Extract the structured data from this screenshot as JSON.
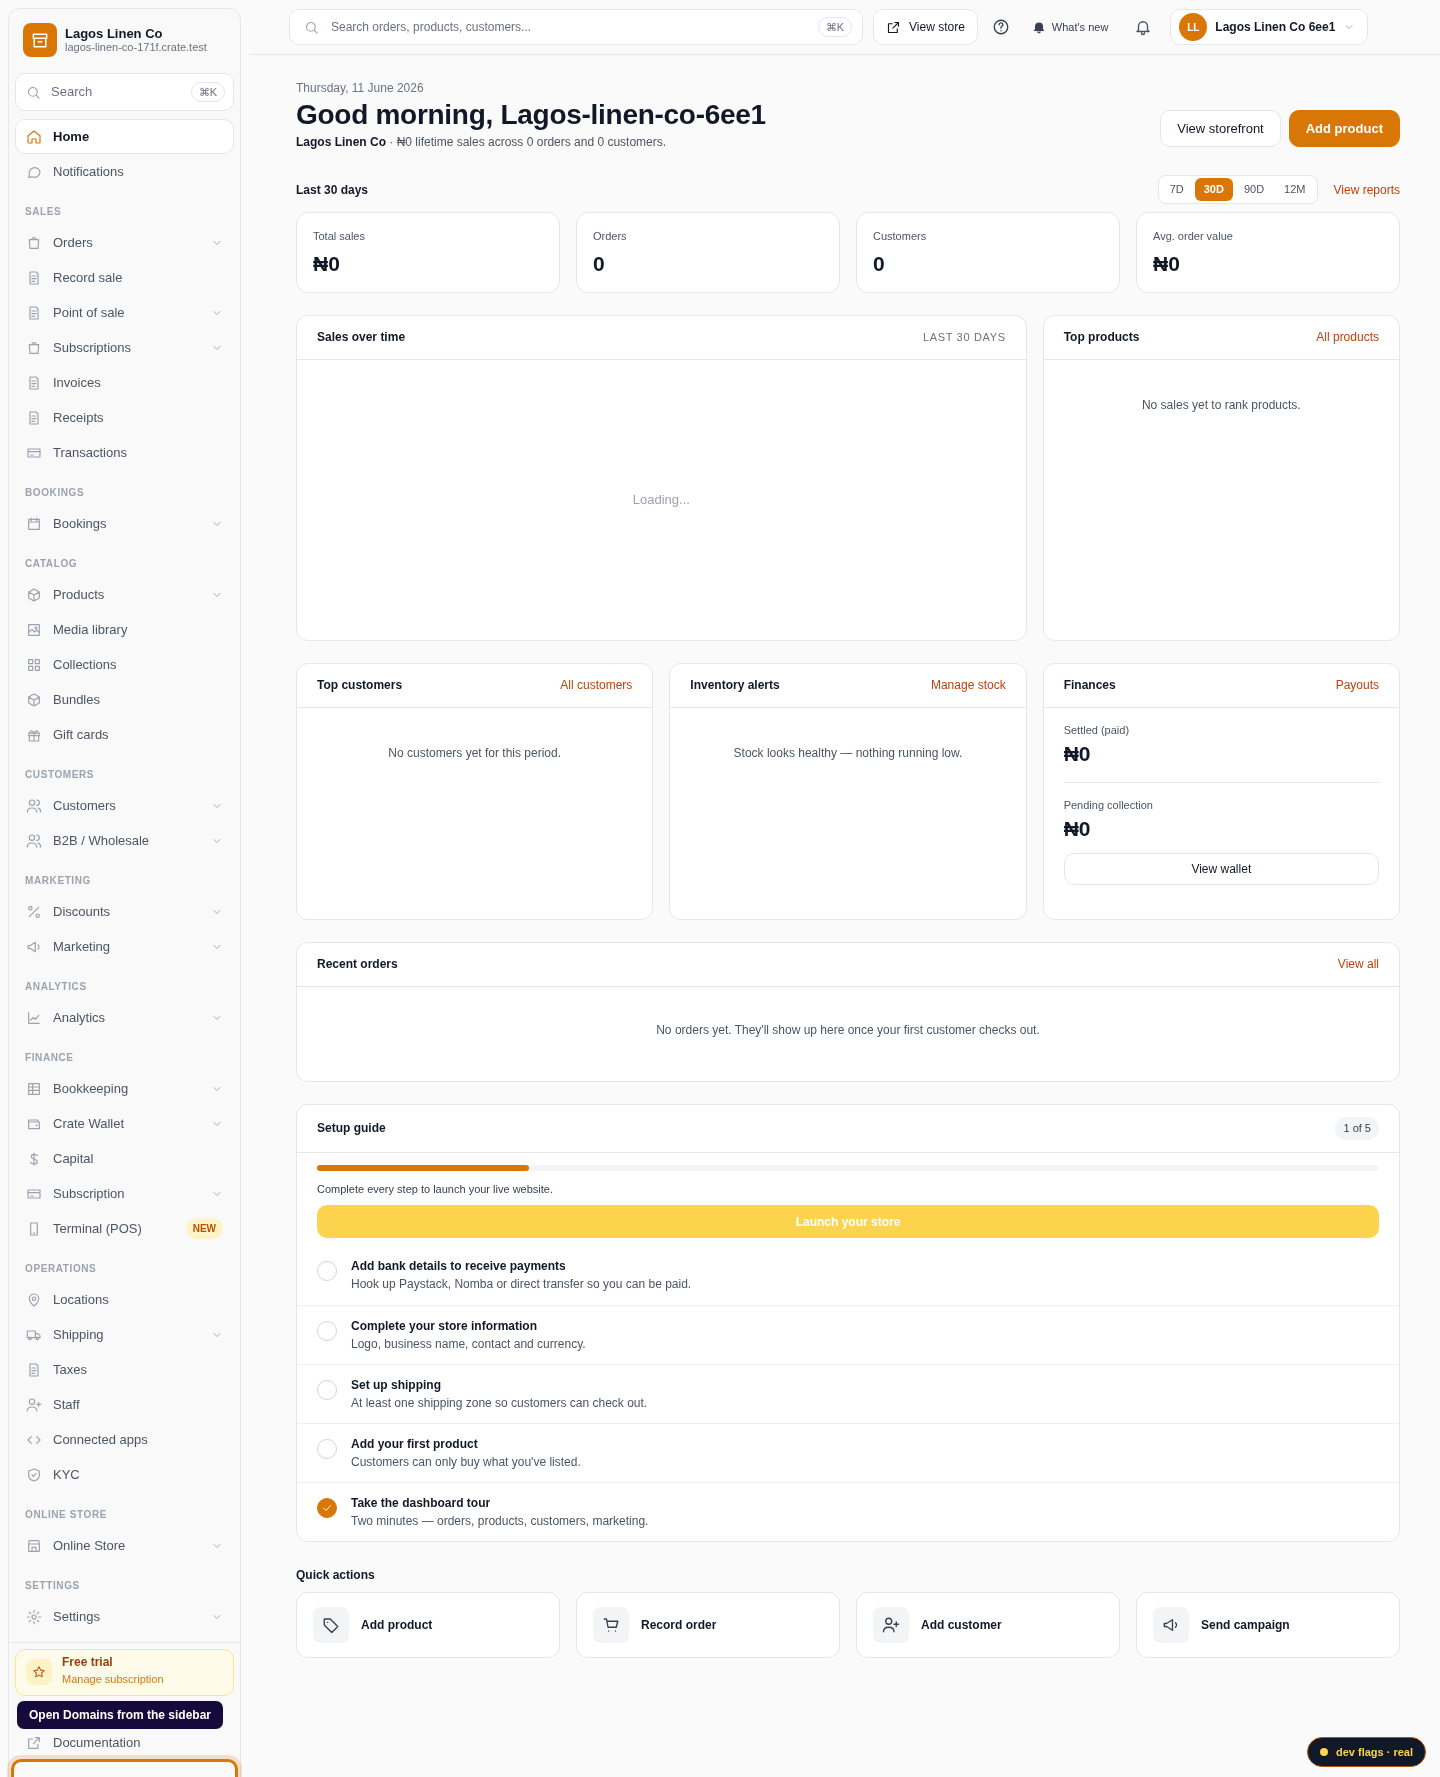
{
  "sidebar": {
    "brand": {
      "name": "Lagos Linen Co",
      "domain": "lagos-linen-co-171f.crate.test"
    },
    "search": {
      "placeholder": "Search",
      "shortcut": "⌘K"
    },
    "items": [
      {
        "label": "Home",
        "selected": true,
        "expandable": false
      },
      {
        "label": "Notifications",
        "selected": false,
        "expandable": false
      }
    ],
    "sections": [
      {
        "title": "SALES",
        "items": [
          {
            "label": "Orders",
            "selected": false,
            "expandable": true
          },
          {
            "label": "Record sale",
            "selected": false,
            "expandable": false
          },
          {
            "label": "Point of sale",
            "selected": false,
            "expandable": true
          },
          {
            "label": "Subscriptions",
            "selected": false,
            "expandable": true
          },
          {
            "label": "Invoices",
            "selected": false,
            "expandable": false
          },
          {
            "label": "Receipts",
            "selected": false,
            "expandable": false
          },
          {
            "label": "Transactions",
            "selected": false,
            "expandable": false
          }
        ]
      },
      {
        "title": "BOOKINGS",
        "items": [
          {
            "label": "Bookings",
            "selected": false,
            "expandable": true
          }
        ]
      },
      {
        "title": "CATALOG",
        "items": [
          {
            "label": "Products",
            "selected": false,
            "expandable": true
          },
          {
            "label": "Media library",
            "selected": false,
            "expandable": false
          },
          {
            "label": "Collections",
            "selected": false,
            "expandable": false
          },
          {
            "label": "Bundles",
            "selected": false,
            "expandable": false
          },
          {
            "label": "Gift cards",
            "selected": false,
            "expandable": false
          }
        ]
      },
      {
        "title": "CUSTOMERS",
        "items": [
          {
            "label": "Customers",
            "selected": false,
            "expandable": true
          },
          {
            "label": "B2B / Wholesale",
            "selected": false,
            "expandable": true
          }
        ]
      },
      {
        "title": "MARKETING",
        "items": [
          {
            "label": "Discounts",
            "selected": false,
            "expandable": true
          },
          {
            "label": "Marketing",
            "selected": false,
            "expandable": true
          }
        ]
      },
      {
        "title": "ANALYTICS",
        "items": [
          {
            "label": "Analytics",
            "selected": false,
            "expandable": true
          }
        ]
      },
      {
        "title": "FINANCE",
        "items": [
          {
            "label": "Bookkeeping",
            "selected": false,
            "expandable": true
          },
          {
            "label": "Crate Wallet",
            "selected": false,
            "expandable": true
          },
          {
            "label": "Capital",
            "selected": false,
            "expandable": false
          },
          {
            "label": "Subscription",
            "selected": false,
            "expandable": true
          },
          {
            "label": "Terminal (POS)",
            "selected": false,
            "expandable": false,
            "badge": "NEW"
          }
        ]
      },
      {
        "title": "OPERATIONS",
        "items": [
          {
            "label": "Locations",
            "selected": false,
            "expandable": false
          },
          {
            "label": "Shipping",
            "selected": false,
            "expandable": true
          },
          {
            "label": "Taxes",
            "selected": false,
            "expandable": false
          },
          {
            "label": "Staff",
            "selected": false,
            "expandable": false
          },
          {
            "label": "Connected apps",
            "selected": false,
            "expandable": false
          },
          {
            "label": "KYC",
            "selected": false,
            "expandable": false
          }
        ]
      },
      {
        "title": "ONLINE STORE",
        "items": [
          {
            "label": "Online Store",
            "selected": false,
            "expandable": true
          }
        ]
      },
      {
        "title": "SETTINGS",
        "items": [
          {
            "label": "Settings",
            "selected": false,
            "expandable": true
          }
        ]
      }
    ],
    "trial": {
      "title": "Free trial",
      "link": "Manage subscription"
    },
    "documentation": "Documentation",
    "tooltip": "Open Domains from the sidebar"
  },
  "topbar": {
    "search": {
      "placeholder": "Search orders, products, customers...",
      "shortcut": "⌘K"
    },
    "view_store": "View store",
    "whats_new": "What's new",
    "account": {
      "initials": "LL",
      "name": "Lagos Linen Co 6ee1"
    }
  },
  "header": {
    "date": "Thursday, 11 June 2026",
    "title": "Good morning, Lagos-linen-co-6ee1",
    "subtitle": "**Lagos Linen Co** · ₦0 lifetime sales across 0 orders and 0 customers.",
    "buttons": [
      {
        "label": "View storefront",
        "primary": false
      },
      {
        "label": "Add product",
        "primary": true
      }
    ]
  },
  "range": {
    "label": "Last 30 days",
    "options": [
      {
        "label": "7D",
        "selected": false
      },
      {
        "label": "30D",
        "selected": true
      },
      {
        "label": "90D",
        "selected": false
      },
      {
        "label": "12M",
        "selected": false
      }
    ],
    "link": "View reports"
  },
  "stats": [
    {
      "label": "Total sales",
      "value": "₦0"
    },
    {
      "label": "Orders",
      "value": "0"
    },
    {
      "label": "Customers",
      "value": "0"
    },
    {
      "label": "Avg. order value",
      "value": "₦0"
    }
  ],
  "sales_over_time": {
    "title": "Sales over time",
    "period": "LAST 30 DAYS",
    "status": "Loading..."
  },
  "top_products": {
    "title": "Top products",
    "link": "All products",
    "empty": "No sales yet to rank products."
  },
  "top_customers": {
    "title": "Top customers",
    "link": "All customers",
    "empty": "No customers yet for this period."
  },
  "inventory_alerts": {
    "title": "Inventory alerts",
    "link": "Manage stock",
    "empty": "Stock looks healthy — nothing running low."
  },
  "finances": {
    "title": "Finances",
    "link": "Payouts",
    "rows": [
      {
        "label": "Settled (paid)",
        "value": "₦0"
      },
      {
        "label": "Pending collection",
        "value": "₦0"
      }
    ],
    "button": "View wallet"
  },
  "recent_orders": {
    "title": "Recent orders",
    "link": "View all",
    "empty": "No orders yet. They'll show up here once your first customer checks out."
  },
  "setup_guide": {
    "title": "Setup guide",
    "count": "1 of 5",
    "level": 0.2,
    "note": "Complete every step to launch your live website.",
    "launch": {
      "label": "Launch your store",
      "disabled": true
    },
    "steps": [
      {
        "title": "Add bank details to receive payments",
        "description": "Hook up Paystack, Nomba or direct transfer so you can be paid.",
        "checked": false
      },
      {
        "title": "Complete your store information",
        "description": "Logo, business name, contact and currency.",
        "checked": false
      },
      {
        "title": "Set up shipping",
        "description": "At least one shipping zone so customers can check out.",
        "checked": false
      },
      {
        "title": "Add your first product",
        "description": "Customers can only buy what you've listed.",
        "checked": false
      },
      {
        "title": "Take the dashboard tour",
        "description": "Two minutes — orders, products, customers, marketing.",
        "checked": true
      }
    ]
  },
  "quick_actions": {
    "title": "Quick actions",
    "items": [
      {
        "label": "Add product"
      },
      {
        "label": "Record order"
      },
      {
        "label": "Add customer"
      },
      {
        "label": "Send campaign"
      }
    ]
  },
  "dev_flags": {
    "label": "dev flags · real",
    "color": "#fcd34d"
  }
}
